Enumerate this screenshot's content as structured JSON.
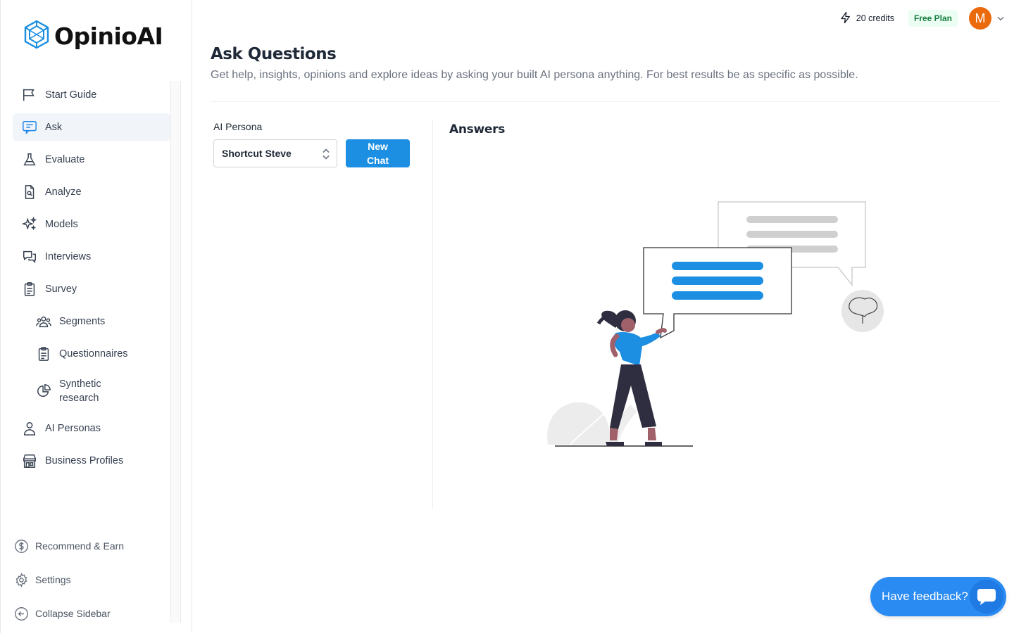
{
  "app": {
    "name": "OpinioAI"
  },
  "sidebar": {
    "items": [
      {
        "label": "Start Guide",
        "icon": "flag-icon"
      },
      {
        "label": "Ask",
        "icon": "chat-icon",
        "active": true
      },
      {
        "label": "Evaluate",
        "icon": "flask-icon"
      },
      {
        "label": "Analyze",
        "icon": "document-search-icon"
      },
      {
        "label": "Models",
        "icon": "sparkles-icon"
      },
      {
        "label": "Interviews",
        "icon": "chat-bubbles-icon"
      },
      {
        "label": "Survey",
        "icon": "clipboard-icon"
      },
      {
        "label": "Segments",
        "icon": "user-group-icon"
      },
      {
        "label": "Questionnaires",
        "icon": "clipboard-list-icon"
      },
      {
        "label": "Synthetic research",
        "icon": "pie-chart-icon"
      },
      {
        "label": "AI Personas",
        "icon": "user-icon"
      },
      {
        "label": "Business Profiles",
        "icon": "building-store-icon"
      }
    ],
    "bottom": [
      {
        "label": "Recommend & Earn",
        "icon": "dollar-circle-icon"
      },
      {
        "label": "Settings",
        "icon": "gear-icon"
      },
      {
        "label": "Collapse Sidebar",
        "icon": "arrow-left-circle-icon"
      }
    ]
  },
  "topbar": {
    "credits": "20 credits",
    "plan": "Free Plan",
    "avatar_initial": "M"
  },
  "main": {
    "title": "Ask Questions",
    "subtitle": "Get help, insights, opinions and explore ideas by asking your built AI persona anything. For best results be as specific as possible.",
    "persona_label": "AI Persona",
    "persona_selected": "Shortcut Steve",
    "new_chat_label": "New Chat",
    "answers_title": "Answers"
  },
  "feedback": {
    "label": "Have feedback?"
  },
  "colors": {
    "accent": "#1c8fe3",
    "avatar": "#ea6a0c",
    "plan_bg": "#ecfdf3",
    "plan_text": "#15803d"
  }
}
